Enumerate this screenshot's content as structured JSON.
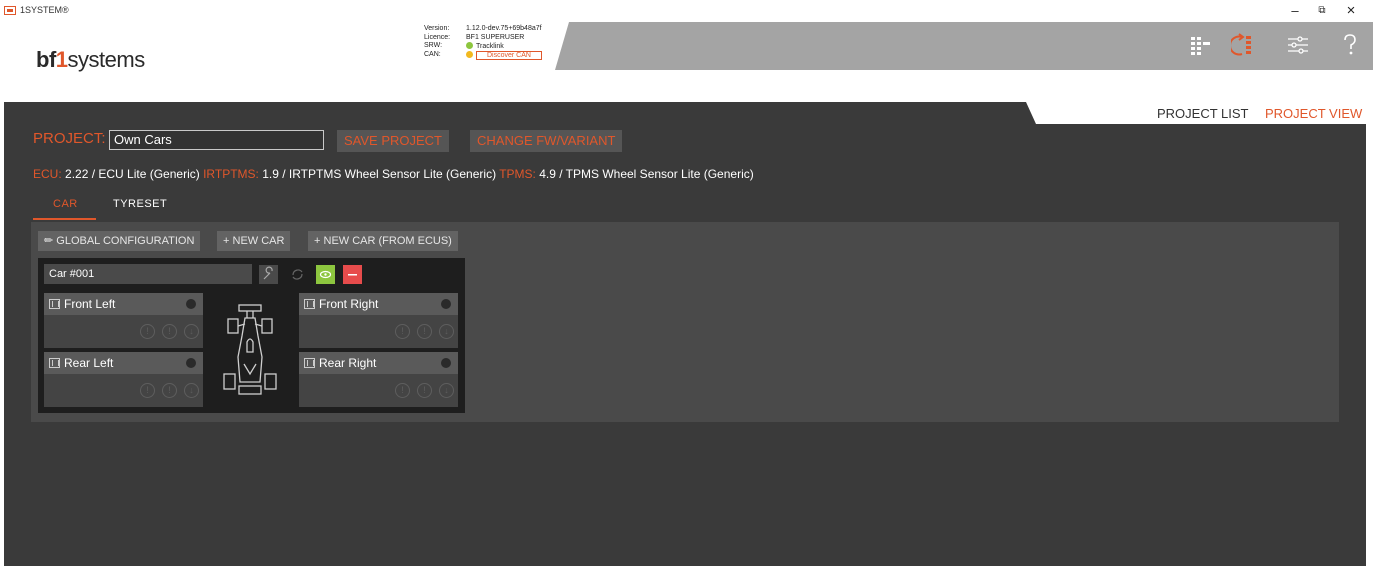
{
  "app": {
    "title": "1SYSTEM®"
  },
  "window": {
    "minimize": "–",
    "restore": "⧉",
    "close": "×"
  },
  "logo": {
    "bf": "bf",
    "one": "1",
    "systems": "systems"
  },
  "info": {
    "version_label": "Version:",
    "version_value": "1.12.0-dev.75+69b48a7f",
    "licence_label": "Licence:",
    "licence_value": "BF1 SUPERUSER",
    "srw_label": "SRW:",
    "srw_value": "Tracklink",
    "can_label": "CAN:",
    "can_button": "Discover CAN"
  },
  "nav": {
    "project_list": "PROJECT LIST",
    "project_view": "PROJECT VIEW"
  },
  "project": {
    "label": "PROJECT:",
    "name": "Own Cars",
    "save_label": "SAVE PROJECT",
    "change_label": "CHANGE FW/VARIANT"
  },
  "ecu_line": {
    "ecu_label": "ECU:",
    "ecu_value": "2.22 / ECU Lite (Generic)",
    "irtptms_label": "IRTPTMS:",
    "irtptms_value": "1.9 / IRTPTMS Wheel Sensor Lite (Generic)",
    "tpms_label": "TPMS:",
    "tpms_value": "4.9 / TPMS Wheel Sensor Lite (Generic)"
  },
  "tabs": [
    {
      "label": "CAR"
    },
    {
      "label": "TYRESET"
    }
  ],
  "toolbar": {
    "global_config": "GLOBAL CONFIGURATION",
    "new_car": "NEW CAR",
    "new_car_from_ecus": "NEW CAR (FROM ECUS)"
  },
  "car": {
    "name": "Car #001",
    "wheels": [
      {
        "label": "Front Left"
      },
      {
        "label": "Front Right"
      },
      {
        "label": "Rear Left"
      },
      {
        "label": "Rear Right"
      }
    ]
  },
  "colors": {
    "accent": "#e0572b",
    "green": "#8dc63f",
    "red": "#e74c4c",
    "dark_bg": "#3a3a3a"
  },
  "icons": [
    "grid-icon",
    "sync-icon",
    "sliders-icon",
    "help-icon",
    "wrench-icon",
    "refresh-icon",
    "eye-icon",
    "minus-icon",
    "tyre-icon",
    "car-icon",
    "info-icon",
    "alert-icon",
    "arrow-down-icon"
  ]
}
